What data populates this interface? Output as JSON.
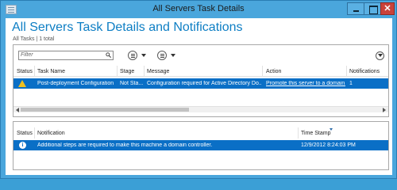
{
  "window": {
    "title": "All Servers Task Details",
    "close_glyph": "✕"
  },
  "header": {
    "title": "All Servers Task Details and Notifications",
    "count": "All Tasks | 1 total"
  },
  "tasks": {
    "filter_placeholder": "Filter",
    "columns": [
      "Status",
      "Task Name",
      "Stage",
      "Message",
      "Action",
      "Notifications"
    ],
    "rows": [
      {
        "status_icon": "warning-icon",
        "task_name": "Post-deployment Configuration",
        "stage": "Not Sta...",
        "message": "Configuration required for Active Directory Do...",
        "action": "Promote this server to a domain...",
        "notifications": "1"
      }
    ]
  },
  "notifications": {
    "columns": [
      "Status",
      "Notification",
      "Time Stamp"
    ],
    "rows": [
      {
        "status_icon": "info-icon",
        "status_glyph": "i",
        "notification": "Additional steps are required to make this machine a domain controller.",
        "time_stamp": "12/9/2012 8:24:03 PM"
      }
    ]
  },
  "colors": {
    "accent": "#0d7ec4",
    "selected_row": "#0a6fc6",
    "window_frame": "#4aa6dc",
    "close_button": "#c9423a"
  }
}
